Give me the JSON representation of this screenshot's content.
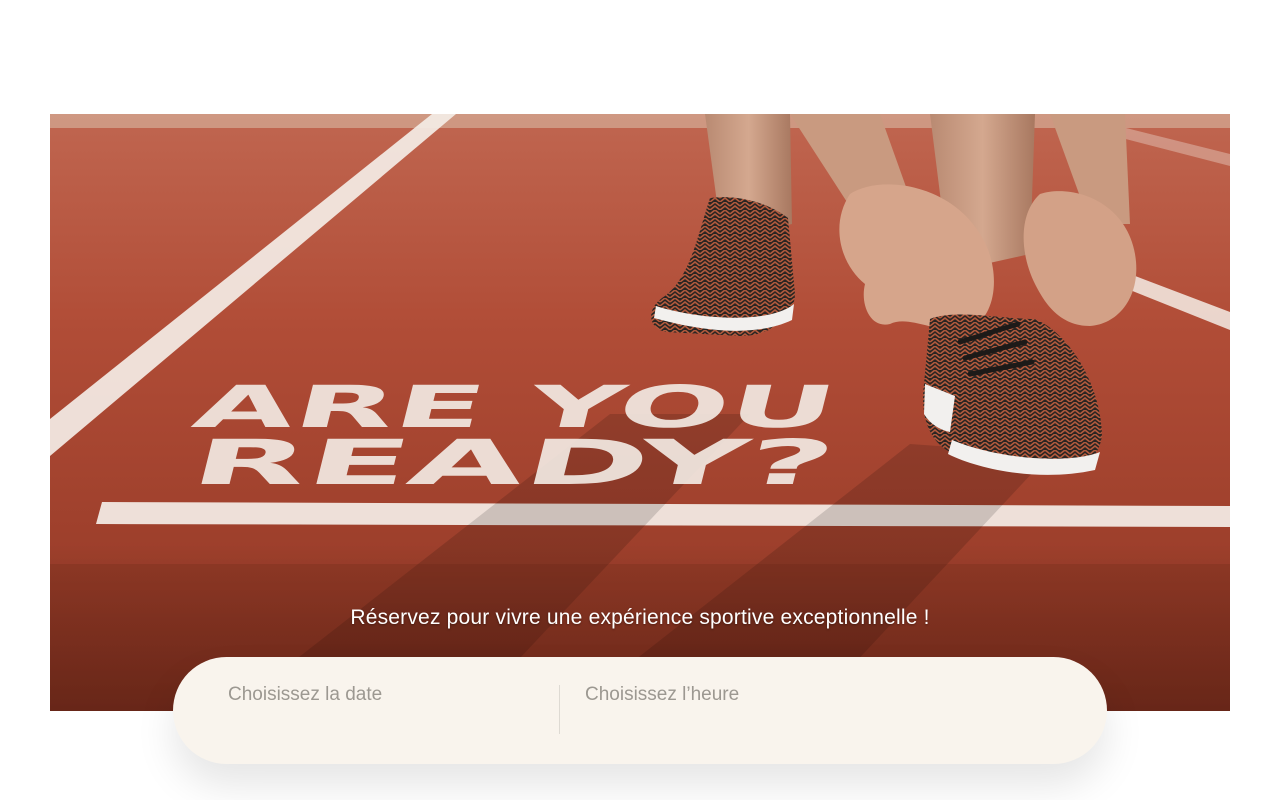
{
  "hero": {
    "image_alt": "Runner tying shoelace on a red running track",
    "track_text_line1": "ARE YOU",
    "track_text_line2": "READY?",
    "tagline": "Réservez pour vivre une expérience sportive exceptionnelle !"
  },
  "booking": {
    "date_label": "Choisissez la date",
    "time_label": "Choisissez l’heure"
  },
  "colors": {
    "track": "#a6402c",
    "bar_background": "#f9f4ed",
    "placeholder_text": "#9c9891"
  }
}
